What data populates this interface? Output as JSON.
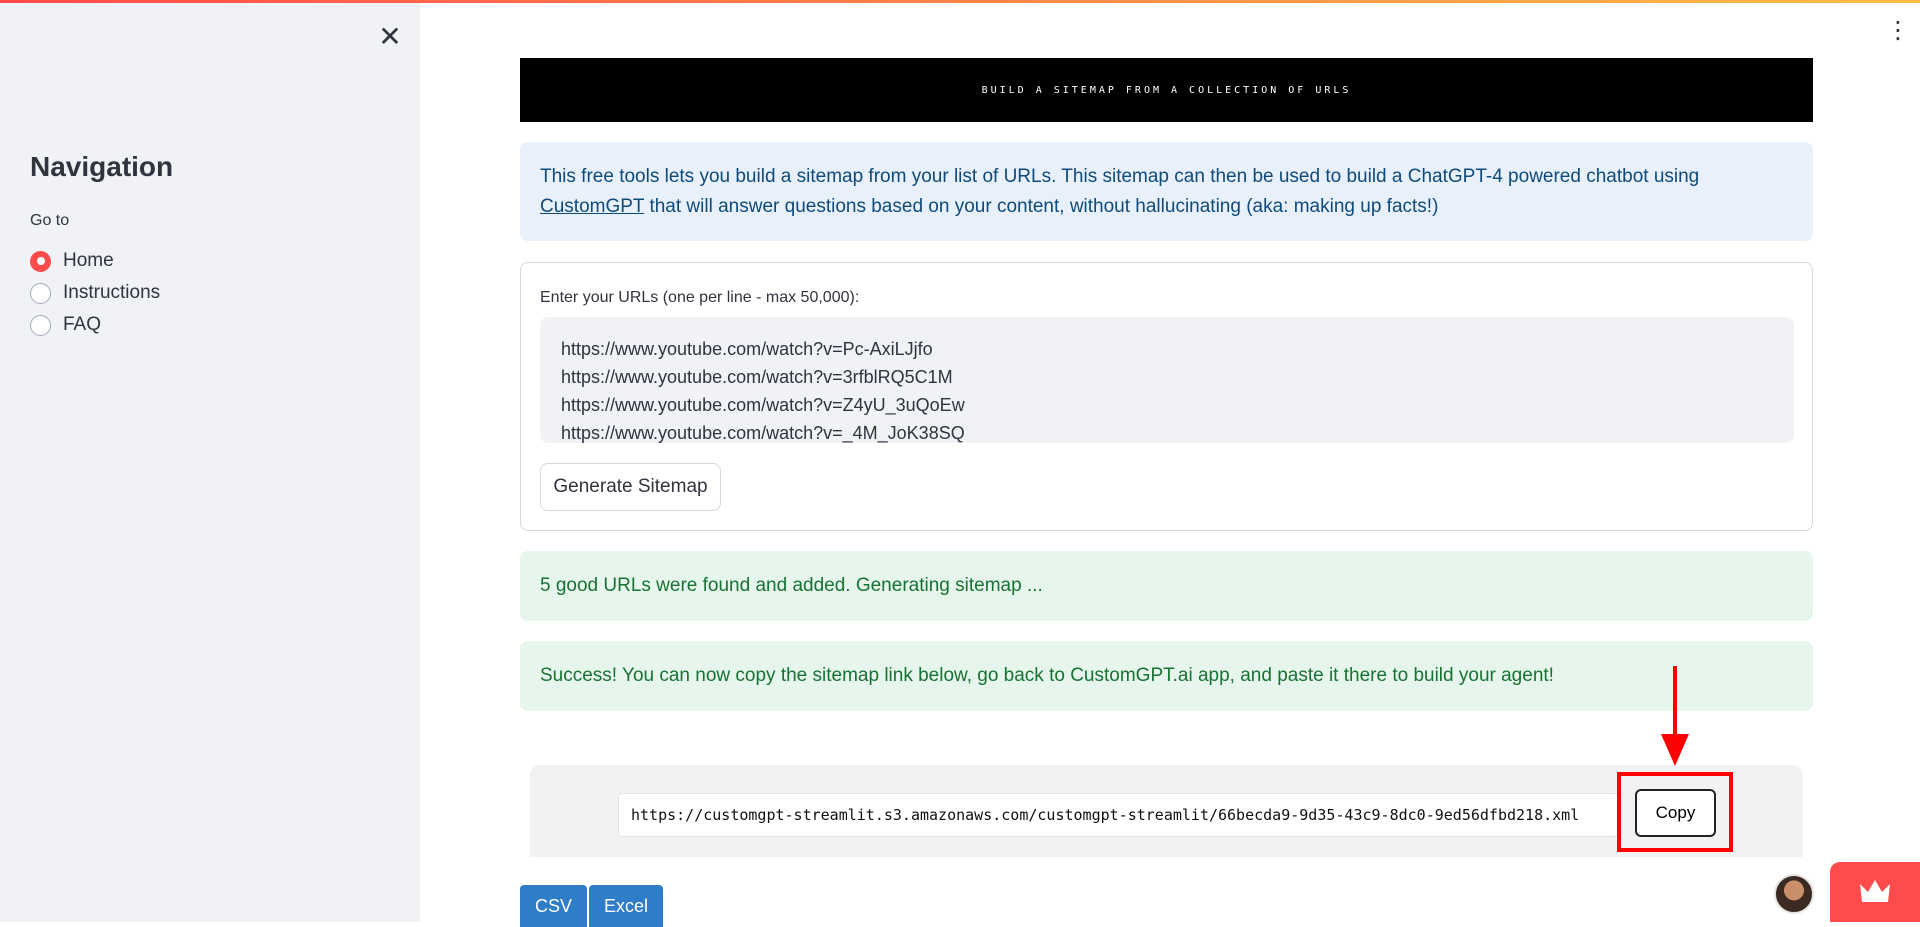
{
  "sidebar": {
    "close_icon": "close-icon",
    "title": "Navigation",
    "goto_label": "Go to",
    "options": [
      {
        "label": "Home",
        "selected": true
      },
      {
        "label": "Instructions",
        "selected": false
      },
      {
        "label": "FAQ",
        "selected": false
      }
    ]
  },
  "header": {
    "banner_text": "BUILD A SITEMAP FROM A COLLECTION OF URLS",
    "menu_icon": "vertical-dots-icon"
  },
  "info": {
    "text_before_link": "This free tools lets you build a sitemap from your list of URLs. This sitemap can then be used to build a ChatGPT-4 powered chatbot using ",
    "link_text": "CustomGPT",
    "text_after_link": " that will answer questions based on your content, without hallucinating (aka: making up facts!)"
  },
  "form": {
    "label": "Enter your URLs (one per line - max 50,000):",
    "urls": "https://www.youtube.com/watch?v=Pc-AxiLJjfo\nhttps://www.youtube.com/watch?v=3rfblRQ5C1M\nhttps://www.youtube.com/watch?v=Z4yU_3uQoEw\nhttps://www.youtube.com/watch?v=_4M_JoK38SQ",
    "generate_label": "Generate Sitemap"
  },
  "messages": {
    "found": "5 good URLs were found and added. Generating sitemap ...",
    "success": "Success! You can now copy the sitemap link below, go back to CustomGPT.ai app, and paste it there to build your agent!"
  },
  "result": {
    "sitemap_url": "https://customgpt-streamlit.s3.amazonaws.com/customgpt-streamlit/66becda9-9d35-43c9-8dc0-9ed56dfbd218.xml",
    "copy_label": "Copy"
  },
  "export": {
    "csv_label": "CSV",
    "excel_label": "Excel"
  },
  "colors": {
    "accent": "#ff4b4b",
    "info_bg": "#e8f1fb",
    "success_bg": "#e7f6ec",
    "annotation_red": "#ff0000",
    "export_blue": "#2f7cc7"
  }
}
